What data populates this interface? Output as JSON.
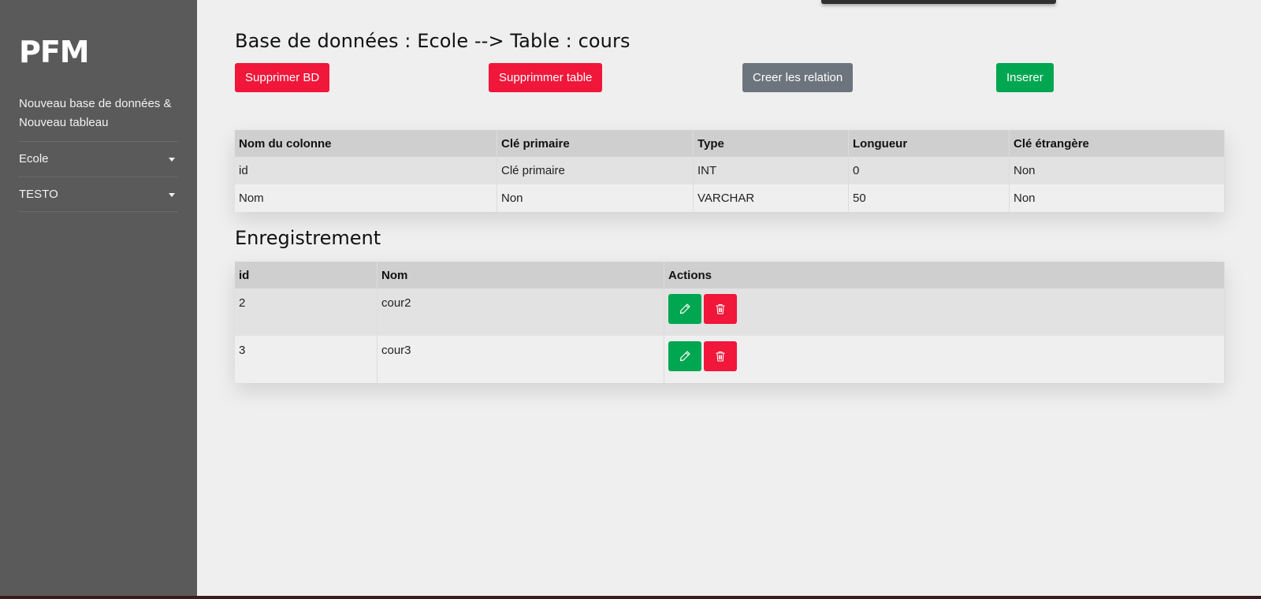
{
  "sidebar": {
    "logo": "PFM",
    "new_link": "Nouveau base de données & Nouveau tableau",
    "items": [
      {
        "label": "Ecole"
      },
      {
        "label": "TESTO"
      }
    ]
  },
  "header": {
    "title": "Base de données : Ecole --> Table : cours"
  },
  "toolbar": {
    "delete_db": "Supprimer BD",
    "delete_table": "Supprimmer table",
    "create_relation": "Creer les relation",
    "insert": "Inserer"
  },
  "columns_table": {
    "headers": [
      "Nom du colonne",
      "Clé primaire",
      "Type",
      "Longueur",
      "Clé étrangère"
    ],
    "rows": [
      [
        "id",
        "Clé primaire",
        "INT",
        "0",
        "Non"
      ],
      [
        "Nom",
        "Non",
        "VARCHAR",
        "50",
        "Non"
      ]
    ]
  },
  "records": {
    "title": "Enregistrement",
    "headers": [
      "id",
      "Nom",
      "Actions"
    ],
    "rows": [
      [
        "2",
        "cour2"
      ],
      [
        "3",
        "cour3"
      ]
    ]
  },
  "icons": {
    "edit": "pencil-icon",
    "delete": "trash-icon",
    "dropdown": "caret-down-icon"
  },
  "colors": {
    "danger": "#f0173a",
    "success": "#00a650",
    "secondary": "#6c757d",
    "sidebar": "#5a5a5a"
  }
}
